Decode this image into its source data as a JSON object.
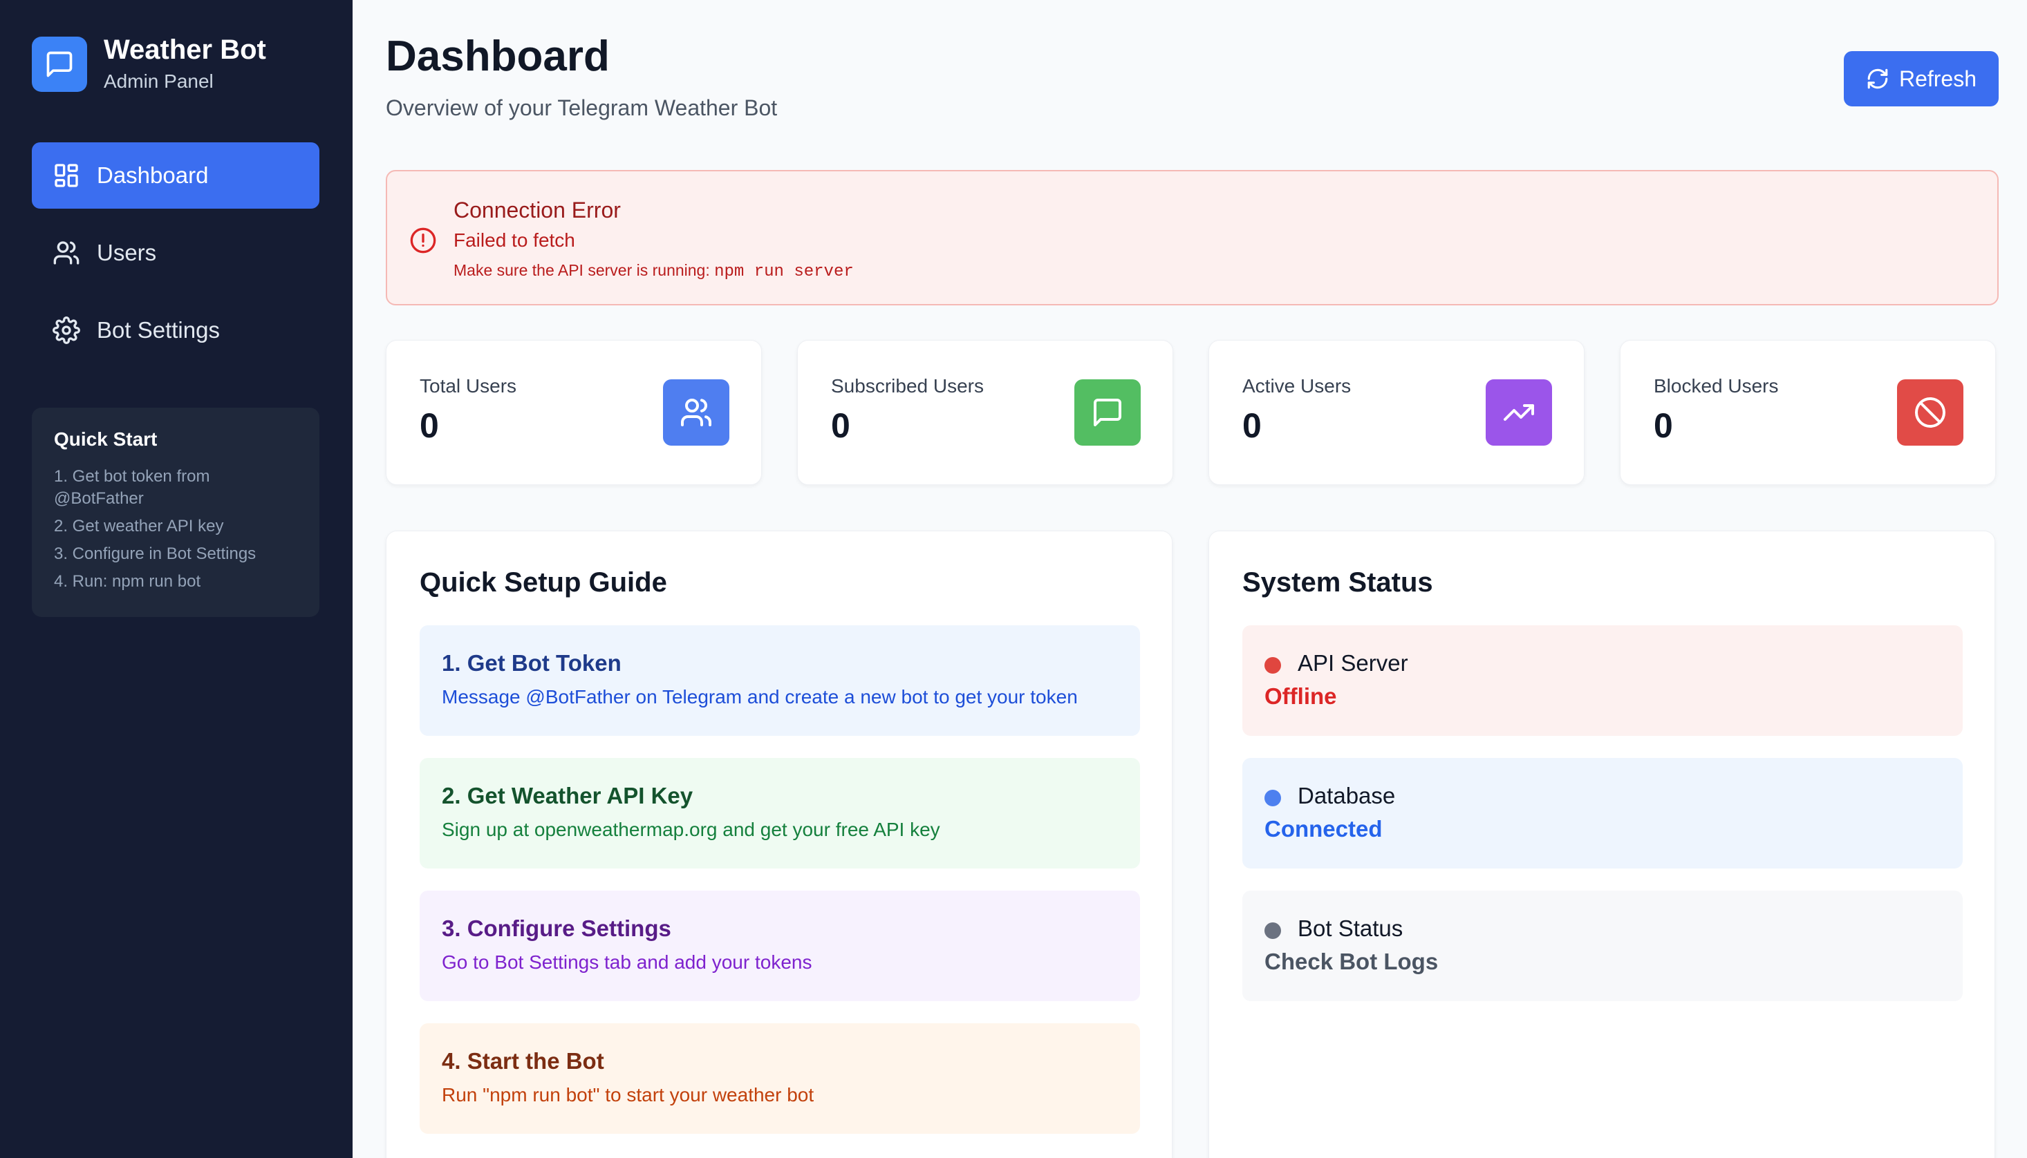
{
  "sidebar": {
    "brand_title": "Weather Bot",
    "brand_subtitle": "Admin Panel",
    "nav": [
      {
        "label": "Dashboard",
        "icon": "grid-icon",
        "active": true
      },
      {
        "label": "Users",
        "icon": "users-icon",
        "active": false
      },
      {
        "label": "Bot Settings",
        "icon": "gear-icon",
        "active": false
      }
    ],
    "quick_start": {
      "title": "Quick Start",
      "steps": [
        "1. Get bot token from",
        "@BotFather",
        "2. Get weather API key",
        "3. Configure in Bot Settings",
        "4. Run: npm run bot"
      ]
    }
  },
  "header": {
    "title": "Dashboard",
    "subtitle": "Overview of your Telegram Weather Bot",
    "refresh_label": "Refresh"
  },
  "error": {
    "title": "Connection Error",
    "message": "Failed to fetch",
    "hint": "Make sure the API server is running:",
    "command": "npm run server"
  },
  "stats": [
    {
      "label": "Total Users",
      "value": "0",
      "icon": "users-icon",
      "color": "#4f7ef0"
    },
    {
      "label": "Subscribed Users",
      "value": "0",
      "icon": "message-icon",
      "color": "#53be62"
    },
    {
      "label": "Active Users",
      "value": "0",
      "icon": "trending-up-icon",
      "color": "#9b55ea"
    },
    {
      "label": "Blocked Users",
      "value": "0",
      "icon": "ban-icon",
      "color": "#e14b47"
    }
  ],
  "setup_guide": {
    "title": "Quick Setup Guide",
    "steps": [
      {
        "title": "1. Get Bot Token",
        "desc": "Message @BotFather on Telegram and create a new bot to get your token"
      },
      {
        "title": "2. Get Weather API Key",
        "desc": "Sign up at openweathermap.org and get your free API key"
      },
      {
        "title": "3. Configure Settings",
        "desc": "Go to Bot Settings tab and add your tokens"
      },
      {
        "title": "4. Start the Bot",
        "desc": "Run \"npm run bot\" to start your weather bot"
      }
    ]
  },
  "system_status": {
    "title": "System Status",
    "items": [
      {
        "name": "API Server",
        "value": "Offline",
        "color": "#dc2626"
      },
      {
        "name": "Database",
        "value": "Connected",
        "color": "#2563eb"
      },
      {
        "name": "Bot Status",
        "value": "Check Bot Logs",
        "color": "#4b5563"
      }
    ]
  }
}
